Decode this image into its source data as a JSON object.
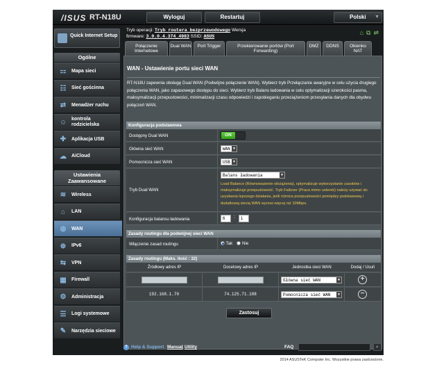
{
  "header": {
    "logo": "/ISUS",
    "model": "RT-N18U",
    "logout_label": "Wyloguj",
    "restart_label": "Restartuj",
    "language": "Polski"
  },
  "info": {
    "mode_label": "Tryb operacji:",
    "mode_value": "Tryb routera bezprzewodowego",
    "version_label": "Wersja",
    "firmware_label": "firmware:",
    "firmware_value": "3.0.0.4.374_4983",
    "ssid_label": "SSID:",
    "ssid_value": "ASUS"
  },
  "sidebar": {
    "qis_label": "Quick Internet Setup",
    "general_header": "Ogólne",
    "general_items": [
      {
        "label": "Mapa sieci",
        "icon": "network-map-icon"
      },
      {
        "label": "Sieć gościnna",
        "icon": "guest-network-icon"
      },
      {
        "label": "Menadżer ruchu",
        "icon": "traffic-manager-icon"
      },
      {
        "label": "kontrola rodzicielska",
        "icon": "parental-control-icon"
      },
      {
        "label": "Aplikacja USB",
        "icon": "usb-app-icon"
      },
      {
        "label": "AiCloud",
        "icon": "cloud-icon"
      }
    ],
    "advanced_header": "Ustawienia Zaawansowane",
    "advanced_items": [
      {
        "label": "Wireless",
        "icon": "wireless-icon"
      },
      {
        "label": "LAN",
        "icon": "lan-icon"
      },
      {
        "label": "WAN",
        "icon": "wan-icon",
        "active": true
      },
      {
        "label": "IPv6",
        "icon": "ipv6-icon"
      },
      {
        "label": "VPN",
        "icon": "vpn-icon"
      },
      {
        "label": "Firewall",
        "icon": "firewall-icon"
      },
      {
        "label": "Administracja",
        "icon": "admin-icon"
      },
      {
        "label": "Logi systemowe",
        "icon": "system-log-icon"
      },
      {
        "label": "Narzędzia sieciowe",
        "icon": "network-tools-icon"
      }
    ]
  },
  "tabs": [
    "Połączenie Internetowe",
    "Dual WAN",
    "Port Trigger",
    "Przekierowanie portów (Port Forwarding)",
    "DMZ",
    "DDNS",
    "Okienko NAT"
  ],
  "page": {
    "title": "WAN - Ustawienie portu sieci WAN",
    "description": "RT-N18U zapewnia obsługę Dual WAN (Podwójne połączenie WAN). Wybierz tryb Przełączanie awaryjne w celu użycia drugiego połączenia WAN, jako zapasowego dostępu do sieci. Wybierz tryb Balans ładowania w celu optymalizacji szerokości pasma, maksymalizacji przepustowości, minimalizacji czasu odpowiedzi i zapobieganiu przeciążeniom przesyłania danych dla obydwu połączeń WAN."
  },
  "basic_config": {
    "header": "Konfiguracja podstawowa",
    "dual_wan_label": "Dostępny Dual WAN",
    "dual_wan_value": "ON",
    "primary_label": "Główna sieć WAN",
    "primary_value": "WAN",
    "secondary_label": "Pomocnicza sieć WAN",
    "secondary_value": "USB",
    "mode_label": "Tryb Dual WAN",
    "mode_value": "Balans ładowania",
    "mode_note": "Load Balance (Równoważenie obciążenia), optymalizuje wykorzystanie zasobów i maksymalizuje przepustowość. Tryb Failover (Praca mimo usterek) należy używać do uzyskania lepszego działania, jeśli różnica przepustowości pomiędzy podstawową i dodatkową siecią WAN wynosi więcej niż 10Mbps.",
    "balance_label": "Konfiguracja balansu ładowania",
    "balance_a": "6",
    "balance_sep": ":",
    "balance_b": "1"
  },
  "routing_rules": {
    "header": "Zasady routingu dla podwójnej sieci WAN",
    "enable_label": "Włączenie zasad routingu",
    "yes_label": "Tak",
    "no_label": "Nie"
  },
  "routing_table": {
    "header": "Zasady routingu (Maks. ilość : 32)",
    "columns": [
      "Źródłowy adres IP",
      "Docelowy adres IP",
      "Jednostka sieci WAN",
      "Dodaj / Usuń"
    ],
    "new_row_wan": "Główna sieć WAN",
    "rows": [
      {
        "src": "192.168.1.70",
        "dst": "74.125.71.108",
        "wan": "Pomocnicza sieć WAN"
      }
    ]
  },
  "apply_label": "Zastosuj",
  "footer": {
    "help": "Help & Support",
    "manual": "Manual",
    "sep": "|",
    "utility": "Utility",
    "faq": "FAQ"
  },
  "copyright": "2014 ASUSTeK Computer Inc. Wszystkie prawa zastrzeżone."
}
